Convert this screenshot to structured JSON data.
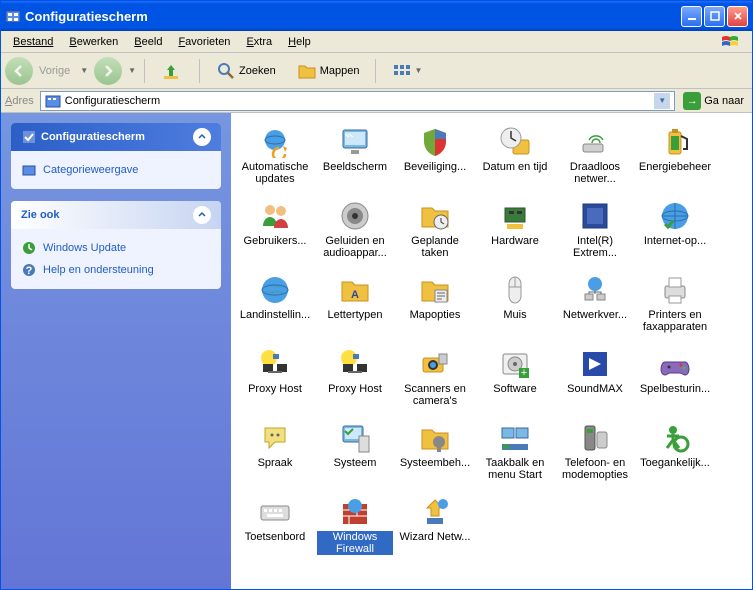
{
  "title": "Configuratiescherm",
  "menus": {
    "file": "Bestand",
    "edit": "Bewerken",
    "view": "Beeld",
    "favorites": "Favorieten",
    "extra": "Extra",
    "help": "Help"
  },
  "toolbar": {
    "back": "Vorige",
    "search": "Zoeken",
    "folders": "Mappen"
  },
  "address": {
    "label": "Adres",
    "value": "Configuratiescherm",
    "go": "Ga naar"
  },
  "sidebar": {
    "panel1": {
      "title": "Configuratiescherm",
      "link": "Categorieweergave"
    },
    "panel2": {
      "title": "Zie ook",
      "link1": "Windows Update",
      "link2": "Help en ondersteuning"
    }
  },
  "items": [
    {
      "id": "auto-updates",
      "label": "Automatische updates",
      "icon": "globe-refresh"
    },
    {
      "id": "display",
      "label": "Beeldscherm",
      "icon": "monitor"
    },
    {
      "id": "security",
      "label": "Beveiliging...",
      "icon": "shield"
    },
    {
      "id": "datetime",
      "label": "Datum en tijd",
      "icon": "clock"
    },
    {
      "id": "wireless",
      "label": "Draadloos netwer...",
      "icon": "wifi"
    },
    {
      "id": "power",
      "label": "Energiebeheer",
      "icon": "battery"
    },
    {
      "id": "users",
      "label": "Gebruikers...",
      "icon": "users"
    },
    {
      "id": "sounds",
      "label": "Geluiden en audioappar...",
      "icon": "speaker"
    },
    {
      "id": "scheduled",
      "label": "Geplande taken",
      "icon": "folder-clock"
    },
    {
      "id": "hardware",
      "label": "Hardware",
      "icon": "hardware"
    },
    {
      "id": "intel",
      "label": "Intel(R) Extrem...",
      "icon": "intel"
    },
    {
      "id": "internet",
      "label": "Internet-op...",
      "icon": "internet"
    },
    {
      "id": "regional",
      "label": "Landinstellin...",
      "icon": "globe"
    },
    {
      "id": "fonts",
      "label": "Lettertypen",
      "icon": "fonts"
    },
    {
      "id": "folder-opts",
      "label": "Mapopties",
      "icon": "folder-opts"
    },
    {
      "id": "mouse",
      "label": "Muis",
      "icon": "mouse"
    },
    {
      "id": "network",
      "label": "Netwerkver...",
      "icon": "network"
    },
    {
      "id": "printers",
      "label": "Printers en faxapparaten",
      "icon": "printer"
    },
    {
      "id": "proxy1",
      "label": "Proxy Host",
      "icon": "proxy"
    },
    {
      "id": "proxy2",
      "label": "Proxy Host",
      "icon": "proxy"
    },
    {
      "id": "scanners",
      "label": "Scanners en camera's",
      "icon": "camera"
    },
    {
      "id": "software",
      "label": "Software",
      "icon": "software"
    },
    {
      "id": "soundmax",
      "label": "SoundMAX",
      "icon": "soundmax"
    },
    {
      "id": "game",
      "label": "Spelbesturin...",
      "icon": "gamepad"
    },
    {
      "id": "speech",
      "label": "Spraak",
      "icon": "speech"
    },
    {
      "id": "system",
      "label": "Systeem",
      "icon": "system"
    },
    {
      "id": "sysadmin",
      "label": "Systeembeh...",
      "icon": "admin"
    },
    {
      "id": "taskbar",
      "label": "Taakbalk en menu Start",
      "icon": "taskbar"
    },
    {
      "id": "phone",
      "label": "Telefoon- en modemopties",
      "icon": "phone"
    },
    {
      "id": "accessibility",
      "label": "Toegankelijk...",
      "icon": "accessibility"
    },
    {
      "id": "keyboard",
      "label": "Toetsenbord",
      "icon": "keyboard"
    },
    {
      "id": "firewall",
      "label": "Windows Firewall",
      "icon": "firewall",
      "selected": true
    },
    {
      "id": "wizard",
      "label": "Wizard Netw...",
      "icon": "wizard"
    }
  ]
}
